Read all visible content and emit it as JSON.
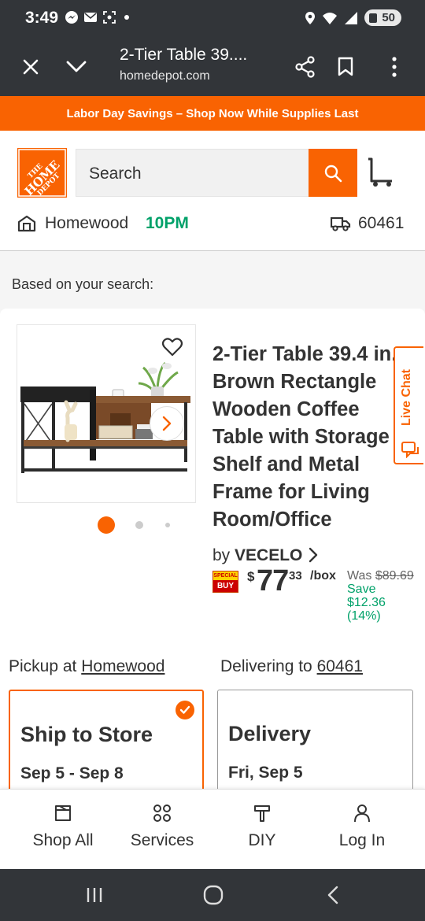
{
  "status_bar": {
    "time": "3:49",
    "battery": "50"
  },
  "toolbar": {
    "title": "2-Tier Table 39....",
    "url": "homedepot.com"
  },
  "promo": {
    "text": "Labor Day Savings – Shop Now While Supplies Last"
  },
  "header": {
    "logo_line1": "THE",
    "logo_line2": "HOME",
    "logo_line3": "DEPOT",
    "search_placeholder": "Search",
    "store_name": "Homewood",
    "store_closes": "10PM",
    "zip": "60461"
  },
  "content": {
    "based_on": "Based on your search:",
    "product": {
      "title": "2-Tier Table 39.4 in.\nBrown Rectangle\nWooden Coffee\nTable with Storage\nShelf and Metal\nFrame for Living\nRoom/Office",
      "by": "by",
      "brand": "VECELO",
      "special_top": "SPECIAL",
      "special_bottom": "BUY",
      "price_dollar": "$",
      "price_main": "77",
      "price_cents": "33",
      "price_unit": "/box",
      "was_label": "Was",
      "was_price": "$89.69",
      "save_line1": "Save",
      "save_line2": "$12.36",
      "save_line3": "(14%)",
      "image_count": 3,
      "active_image": 1
    },
    "live_chat": "Live Chat",
    "fulfillment": {
      "pickup_prefix": "Pickup at",
      "pickup_store": "Homewood",
      "deliver_prefix": "Delivering to",
      "deliver_zip": "60461",
      "ship_title": "Ship to Store",
      "ship_date": "Sep 5 - Sep 8",
      "delivery_title": "Delivery",
      "delivery_date": "Fri, Sep 5"
    }
  },
  "bottom_nav": {
    "shop_all": "Shop All",
    "services": "Services",
    "diy": "DIY",
    "log_in": "Log In"
  },
  "colors": {
    "brand_orange": "#f96302",
    "green": "#00a169",
    "dark_chrome": "#323539"
  }
}
